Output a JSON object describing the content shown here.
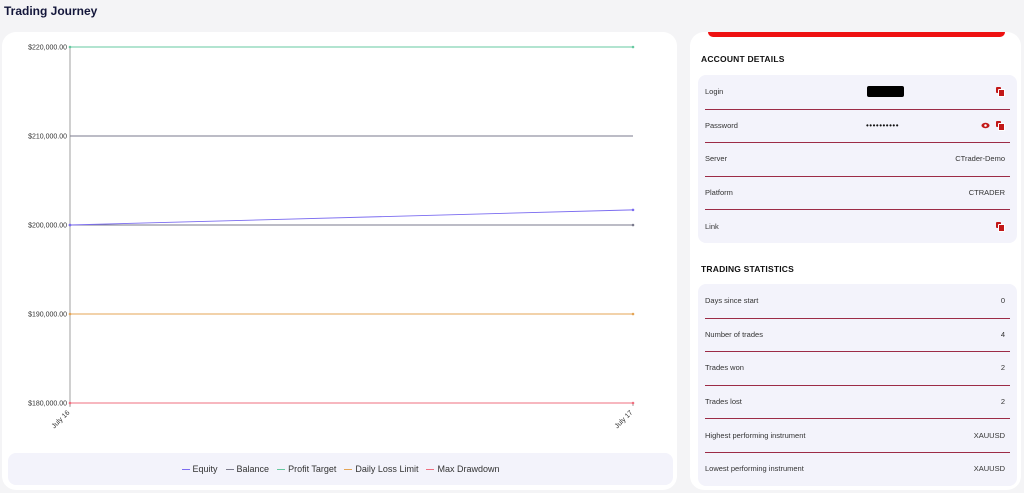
{
  "page": {
    "title": "Trading Journey"
  },
  "chart_data": {
    "type": "line",
    "categories": [
      "July 16",
      "July 17"
    ],
    "y_ticks": [
      "$180,000.00",
      "$190,000.00",
      "$200,000.00",
      "$210,000.00",
      "$220,000.00"
    ],
    "ylim": [
      180000,
      220000
    ],
    "grid": false,
    "legend_position": "bottom",
    "series": [
      {
        "name": "Equity",
        "color": "#7b6cf0",
        "values": [
          200000,
          201700
        ]
      },
      {
        "name": "Balance",
        "color": "#7a7a8c",
        "values": [
          200000,
          200000
        ]
      },
      {
        "name": "Profit Target",
        "color": "#66c9a0",
        "values": [
          220000,
          220000
        ]
      },
      {
        "name": "Daily Loss Limit",
        "color": "#e4a455",
        "values": [
          190000,
          190000
        ]
      },
      {
        "name": "Max Drawdown",
        "color": "#ef6f7f",
        "values": [
          180000,
          180000
        ]
      }
    ],
    "extra_line": {
      "color": "#7a7a8c",
      "values": [
        210000,
        210000
      ]
    }
  },
  "account": {
    "title": "ACCOUNT DETAILS",
    "rows": [
      {
        "label": "Login",
        "value": ""
      },
      {
        "label": "Password",
        "value": "••••••••••"
      },
      {
        "label": "Server",
        "value": "CTrader-Demo"
      },
      {
        "label": "Platform",
        "value": "CTRADER"
      },
      {
        "label": "Link",
        "value": ""
      }
    ]
  },
  "stats": {
    "title": "TRADING STATISTICS",
    "rows": [
      {
        "label": "Days since start",
        "value": "0"
      },
      {
        "label": "Number of trades",
        "value": "4"
      },
      {
        "label": "Trades won",
        "value": "2"
      },
      {
        "label": "Trades lost",
        "value": "2"
      },
      {
        "label": "Highest performing instrument",
        "value": "XAUUSD"
      },
      {
        "label": "Lowest performing instrument",
        "value": "XAUUSD"
      }
    ]
  },
  "icons": {
    "copy": "copy-icon",
    "reveal": "eye-icon"
  },
  "colors": {
    "accent_red": "#ee1111",
    "divider": "#9c2b46",
    "panel_bg": "#f3f3fb"
  }
}
